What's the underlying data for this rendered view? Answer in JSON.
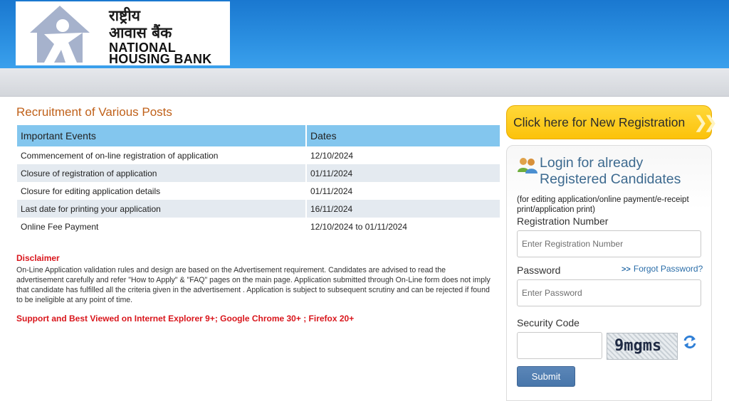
{
  "header": {
    "logo_hindi_line1": "राष्ट्रीय",
    "logo_hindi_line2": "आवास बैंक",
    "logo_english_line1": "NATIONAL",
    "logo_english_line2": "HOUSING BANK",
    "logo_icon": "house-person-logo-icon"
  },
  "main": {
    "title": "Recruitment of Various Posts",
    "table": {
      "headers": [
        "Important Events",
        "Dates"
      ],
      "rows": [
        [
          "Commencement of on-line registration of application",
          "12/10/2024"
        ],
        [
          "Closure of registration of application",
          "01/11/2024"
        ],
        [
          "Closure for editing application details",
          "01/11/2024"
        ],
        [
          "Last date for printing your application",
          "16/11/2024"
        ],
        [
          "Online Fee Payment",
          "12/10/2024 to 01/11/2024"
        ]
      ]
    },
    "disclaimer_title": "Disclaimer",
    "disclaimer_text": "On-Line Application validation rules and design are based on the Advertisement requirement. Candidates are advised to read the advertisement carefully and refer \"How to Apply\" & \"FAQ\" pages on the main page. Application submitted through On-Line form does not imply that candidate has fulfilled all the criteria given in the advertisement . Application is subject to subsequent scrutiny and can be rejected if found to be ineligible at any point of time.",
    "support_text": "Support and Best Viewed on Internet Explorer 9+; Google Chrome 30+ ; Firefox 20+"
  },
  "sidebar": {
    "new_registration_label": "Click here for New Registration",
    "login": {
      "heading_line1": "Login for already",
      "heading_line2": "Registered Candidates",
      "note": "(for editing application/online payment/e-receipt print/application print)",
      "registration_label": "Registration Number",
      "registration_placeholder": "Enter Registration Number",
      "password_label": "Password",
      "password_placeholder": "Enter Password",
      "forgot_password": "Forgot Password?",
      "security_code_label": "Security Code",
      "captcha_text": "9mgms",
      "submit_label": "Submit"
    }
  },
  "colors": {
    "header_blue": "#2a8ee0",
    "title_orange": "#c0611a",
    "table_header": "#83c6ee",
    "alert_red": "#d9161c",
    "button_yellow": "#fcc20a",
    "link_blue": "#2a6da8"
  }
}
